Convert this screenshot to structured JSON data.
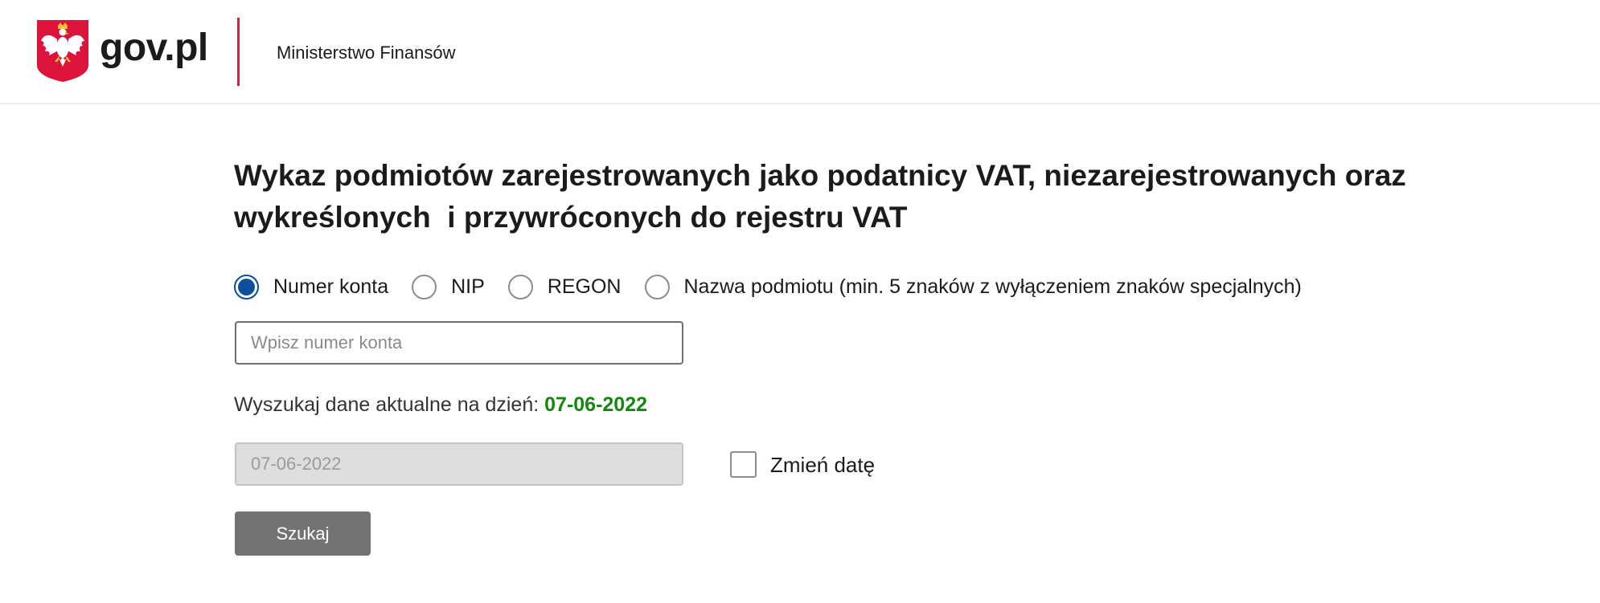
{
  "header": {
    "logo_text": "gov.pl",
    "emblem_icon": "polish-eagle-emblem-icon",
    "ministry": "Ministerstwo Finansów",
    "accent_color": "#d4213d"
  },
  "main": {
    "title_line1": "Wykaz podmiotów zarejestrowanych jako podatnicy VAT, niezarejestrowanych oraz",
    "title_line2": "wykreślonych  i przywróconych do rejestru VAT",
    "search_type": {
      "selected": "Numer konta",
      "options": [
        {
          "label": "Numer konta",
          "checked": true
        },
        {
          "label": "NIP",
          "checked": false
        },
        {
          "label": "REGON",
          "checked": false
        },
        {
          "label": "Nazwa podmiotu (min. 5 znaków z wyłączeniem znaków specjalnych)",
          "checked": false
        }
      ]
    },
    "search_input": {
      "value": "",
      "placeholder": "Wpisz numer konta"
    },
    "date_info": {
      "label": "Wyszukaj dane aktualne na dzień:",
      "value": "07-06-2022",
      "value_color": "#14870f"
    },
    "date_input": {
      "value": "07-06-2022",
      "disabled": true
    },
    "change_date_checkbox": {
      "label": "Zmień datę",
      "checked": false
    },
    "search_button": {
      "label": "Szukaj",
      "color": "#737373"
    },
    "primary_color": "#0c4f9c"
  }
}
